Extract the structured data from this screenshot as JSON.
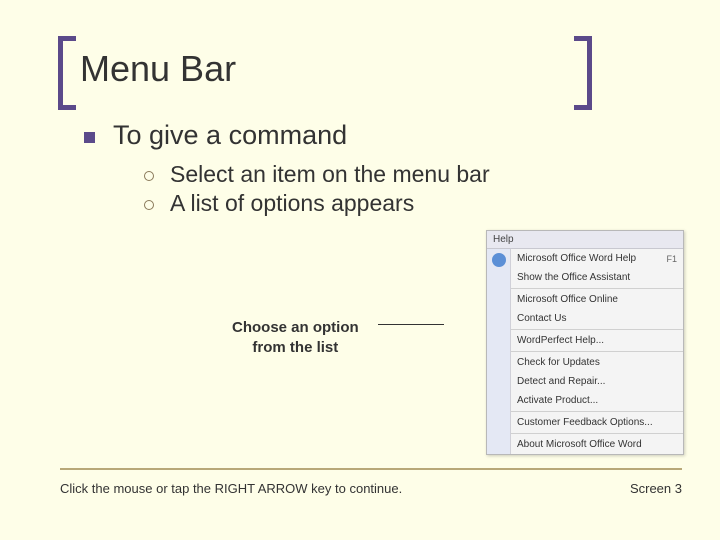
{
  "title": "Menu Bar",
  "bullets": {
    "lvl1": "To give a command",
    "lvl2": [
      "Select an item on the menu bar",
      "A list of options appears"
    ]
  },
  "callout": {
    "line1": "Choose an option",
    "line2": "from the list"
  },
  "menu": {
    "header": "Help",
    "items": [
      {
        "label": "Microsoft Office Word Help",
        "shortcut": "F1"
      },
      {
        "label": "Show the Office Assistant",
        "shortcut": ""
      },
      {
        "label": "Microsoft Office Online",
        "shortcut": ""
      },
      {
        "label": "Contact Us",
        "shortcut": ""
      },
      {
        "label": "WordPerfect Help...",
        "shortcut": ""
      },
      {
        "label": "Check for Updates",
        "shortcut": ""
      },
      {
        "label": "Detect and Repair...",
        "shortcut": ""
      },
      {
        "label": "Activate Product...",
        "shortcut": ""
      },
      {
        "label": "Customer Feedback Options...",
        "shortcut": ""
      },
      {
        "label": "About Microsoft Office Word",
        "shortcut": ""
      }
    ]
  },
  "footer": {
    "left": "Click the mouse or tap the RIGHT ARROW key to continue.",
    "right": "Screen 3"
  }
}
